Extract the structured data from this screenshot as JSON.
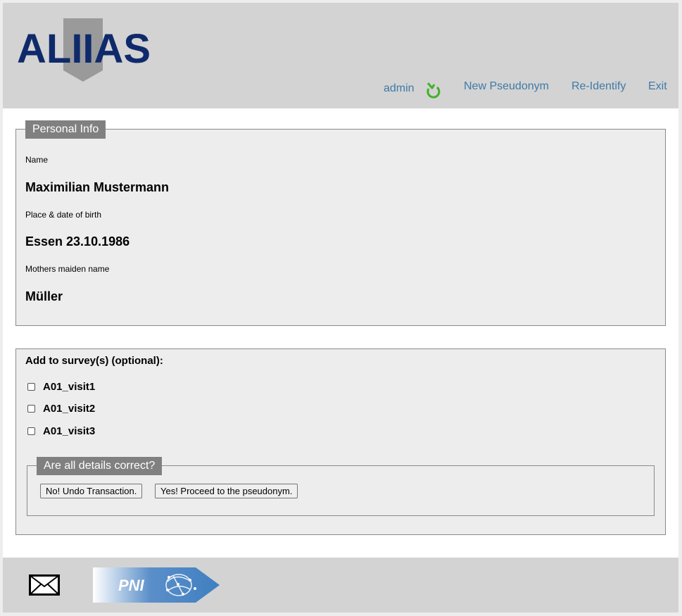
{
  "header": {
    "logo_text": "ALIIAS",
    "user": "admin",
    "icons": {
      "user": "refresh-user-icon"
    },
    "nav": {
      "new_pseudonym": "New Pseudonym",
      "re_identify": "Re-Identify",
      "exit": "Exit"
    }
  },
  "personal_info": {
    "legend": "Personal Info",
    "name_label": "Name",
    "name_value": "Maximilian Mustermann",
    "birth_label": "Place & date of birth",
    "birth_value": "Essen 23.10.1986",
    "maiden_label": "Mothers maiden name",
    "maiden_value": "Müller"
  },
  "surveys": {
    "title": "Add to survey(s) (optional):",
    "items": [
      {
        "label": "A01_visit1",
        "checked": false
      },
      {
        "label": "A01_visit2",
        "checked": false
      },
      {
        "label": "A01_visit3",
        "checked": false
      }
    ]
  },
  "confirm": {
    "legend": "Are all details correct?",
    "no_button": "No! Undo Transaction.",
    "yes_button": "Yes! Proceed to the pseudonym."
  },
  "footer": {
    "mail_icon": "mail-icon",
    "logo_text": "PNI"
  },
  "colors": {
    "nav_link": "#3f7aa8",
    "logo_navy": "#0f2a6b",
    "header_bg": "#d3d3d3",
    "legend_bg": "#808080",
    "user_icon_green": "#43b02a",
    "pni_blue": "#3f7fc1"
  }
}
